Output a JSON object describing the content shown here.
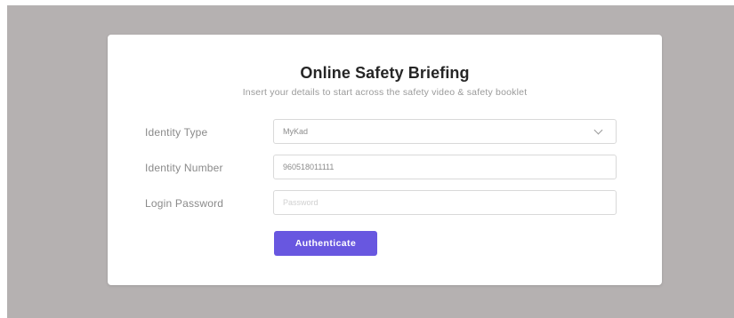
{
  "form": {
    "title": "Online Safety Briefing",
    "subtitle": "Insert your details to start across the safety video & safety booklet",
    "identity_type": {
      "label": "Identity Type",
      "value": "MyKad"
    },
    "identity_number": {
      "label": "Identity Number",
      "value": "960518011111"
    },
    "login_password": {
      "label": "Login Password",
      "placeholder": "Password"
    },
    "submit_label": "Authenticate"
  },
  "colors": {
    "backdrop": "#b5b1b1",
    "card": "#ffffff",
    "accent": "#6857e0"
  },
  "icons": {
    "dropdown": "chevron-down-icon"
  }
}
